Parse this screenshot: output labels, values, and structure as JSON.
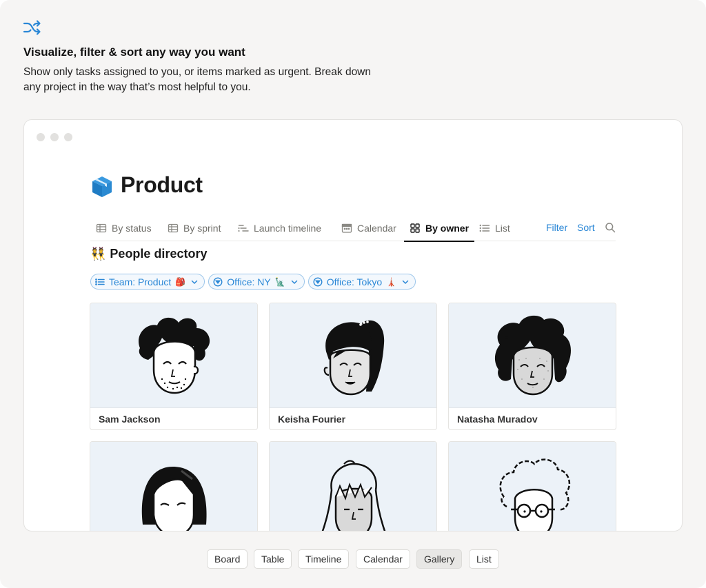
{
  "feature": {
    "icon": "shuffle-icon",
    "title": "Visualize, filter & sort any way you want",
    "description": "Show only tasks assigned to you, or items marked as urgent. Break down any project in the way that’s most helpful to you."
  },
  "page": {
    "icon": "package-box-icon",
    "title": "Product"
  },
  "tabs": [
    {
      "label": "By status",
      "icon": "table-icon",
      "active": false
    },
    {
      "label": "By sprint",
      "icon": "table-icon",
      "active": false
    },
    {
      "label": "Launch timeline",
      "icon": "timeline-icon",
      "active": false
    },
    {
      "label": "Calendar",
      "icon": "calendar-icon",
      "active": false
    },
    {
      "label": "By owner",
      "icon": "gallery-icon",
      "active": true
    },
    {
      "label": "List",
      "icon": "list-icon",
      "active": false
    }
  ],
  "actions": {
    "filter": "Filter",
    "sort": "Sort",
    "search_icon": "search-icon"
  },
  "section": {
    "icon_emoji": "👯",
    "title": "People directory"
  },
  "filters": [
    {
      "label": "Team: Product",
      "emoji": "🎒",
      "icon": "list-icon"
    },
    {
      "label": "Office: NY",
      "emoji": "🗽",
      "icon": "filter-circle-icon"
    },
    {
      "label": "Office: Tokyo",
      "emoji": "🗼",
      "icon": "filter-circle-icon"
    }
  ],
  "people": [
    {
      "name": "Sam Jackson"
    },
    {
      "name": "Keisha Fourier"
    },
    {
      "name": "Natasha Muradov"
    },
    {
      "name": ""
    },
    {
      "name": ""
    },
    {
      "name": ""
    }
  ],
  "view_switcher": [
    {
      "label": "Board",
      "active": false
    },
    {
      "label": "Table",
      "active": false
    },
    {
      "label": "Timeline",
      "active": false
    },
    {
      "label": "Calendar",
      "active": false
    },
    {
      "label": "Gallery",
      "active": true
    },
    {
      "label": "List",
      "active": false
    }
  ],
  "colors": {
    "accent": "#2a87d6",
    "background": "#f6f5f4",
    "card_art": "#ecf2f8"
  }
}
